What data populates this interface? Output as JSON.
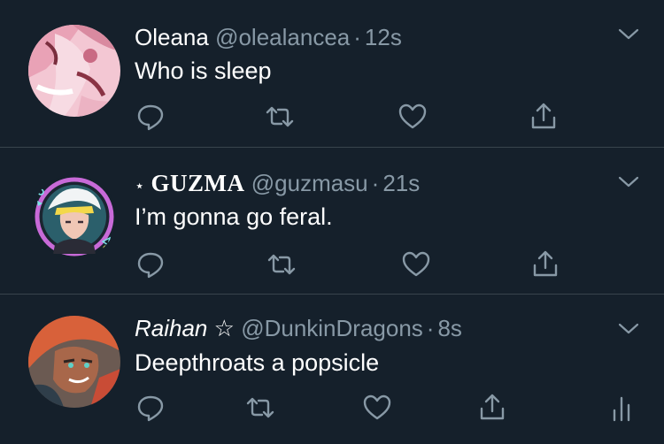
{
  "tweets": [
    {
      "name": "Oleana",
      "handle": "@olealancea",
      "separator": "·",
      "time": "12s",
      "text": "Who is sleep"
    },
    {
      "name_prefix": "⋆",
      "name": "GUZMA",
      "handle": "@guzmasu",
      "separator": "·",
      "time": "21s",
      "text": "I’m gonna go feral."
    },
    {
      "name": "Raihan",
      "name_suffix": "☆",
      "handle": "@DunkinDragons",
      "separator": "·",
      "time": "8s",
      "text": "Deepthroats a popsicle"
    }
  ],
  "colors": {
    "background": "#15202b",
    "secondary_text": "#8899a6",
    "divider": "#38444d"
  },
  "icons": [
    "reply-icon",
    "retweet-icon",
    "like-icon",
    "share-icon",
    "analytics-icon",
    "chevron-down-icon"
  ]
}
